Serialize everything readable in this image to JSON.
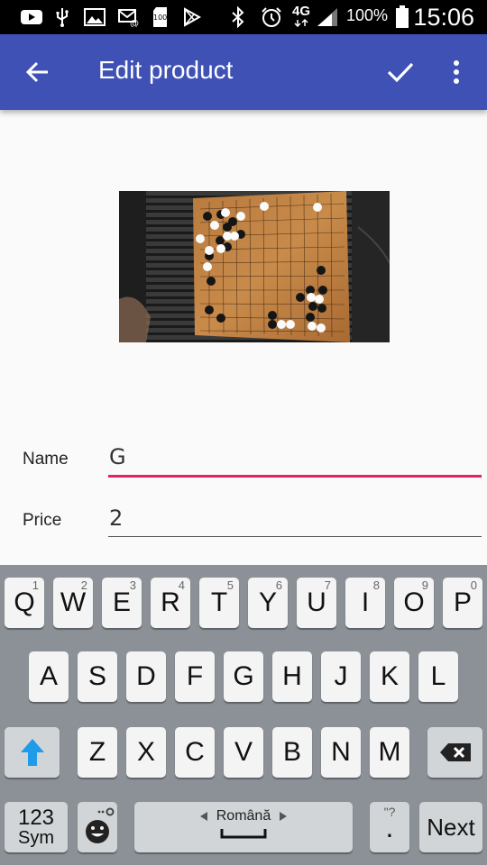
{
  "status_bar": {
    "battery_percent": "100%",
    "network": "4G",
    "time": "15:06",
    "notification_badge": "100",
    "icons": [
      "youtube-icon",
      "usb-icon",
      "image-icon",
      "email-icon",
      "sd-card-icon",
      "play-store-icon",
      "bluetooth-icon",
      "alarm-icon",
      "network-4g-icon",
      "signal-icon",
      "battery-icon"
    ]
  },
  "app_bar": {
    "title": "Edit product",
    "background": "#3f51b5",
    "back_icon": "arrow-back-icon",
    "save_icon": "check-icon",
    "menu_icon": "more-vert-icon"
  },
  "form": {
    "name": {
      "label": "Name",
      "value": "G",
      "focused": true,
      "accent": "#e91e63"
    },
    "price": {
      "label": "Price",
      "value": "2",
      "focused": false
    }
  },
  "keyboard": {
    "row1": [
      {
        "label": "Q",
        "hint": "1"
      },
      {
        "label": "W",
        "hint": "2"
      },
      {
        "label": "E",
        "hint": "3"
      },
      {
        "label": "R",
        "hint": "4"
      },
      {
        "label": "T",
        "hint": "5"
      },
      {
        "label": "Y",
        "hint": "6"
      },
      {
        "label": "U",
        "hint": "7"
      },
      {
        "label": "I",
        "hint": "8"
      },
      {
        "label": "O",
        "hint": "9"
      },
      {
        "label": "P",
        "hint": "0"
      }
    ],
    "row2": [
      "A",
      "S",
      "D",
      "F",
      "G",
      "H",
      "J",
      "K",
      "L"
    ],
    "row3": [
      "Z",
      "X",
      "C",
      "V",
      "B",
      "N",
      "M"
    ],
    "sym_top": "123",
    "sym_bottom": "Sym",
    "space_label": "Română",
    "punct_top": "\"?",
    "punct_main": ".",
    "next_label": "Next",
    "shift_color": "#1e9be9"
  }
}
